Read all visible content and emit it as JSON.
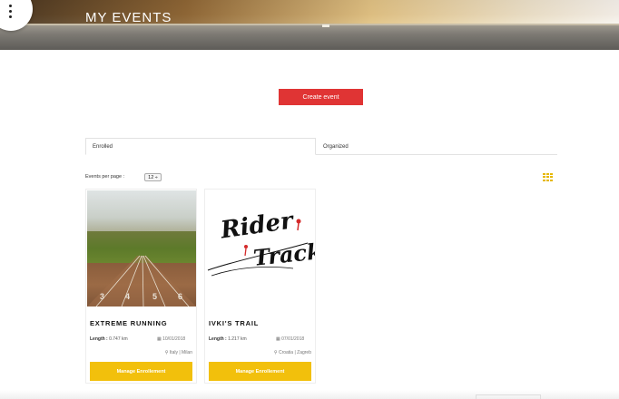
{
  "header": {
    "title": "MY EVENTS",
    "menu_icon": "kebab-menu-icon"
  },
  "actions": {
    "create_event_label": "Create event",
    "create_color": "#e03434"
  },
  "tabs": [
    {
      "label": "Enrolled",
      "active": true
    },
    {
      "label": "Organized",
      "active": false
    }
  ],
  "toolbar": {
    "per_page_label": "Events per page :",
    "per_page_value": "12 ÷",
    "view_icon": "grid-view-icon"
  },
  "events": [
    {
      "title": "EXTREME RUNNING",
      "length_label": "Length :",
      "length_value": "0.747 km",
      "date": "10/01/2018",
      "location": "Italy | Milan",
      "button_label": "Manage Enrollement",
      "track_numbers": [
        "3",
        "4",
        "5",
        "6"
      ]
    },
    {
      "title": "IVKI'S TRAIL",
      "length_label": "Length :",
      "length_value": "1.217 km",
      "date": "07/01/2018",
      "location": "Croatia | Zagreb",
      "button_label": "Manage Enrollement",
      "logo_text_1": "Rider",
      "logo_text_2": "Track"
    }
  ],
  "colors": {
    "accent_yellow": "#f2c00c",
    "accent_red": "#e03434"
  }
}
